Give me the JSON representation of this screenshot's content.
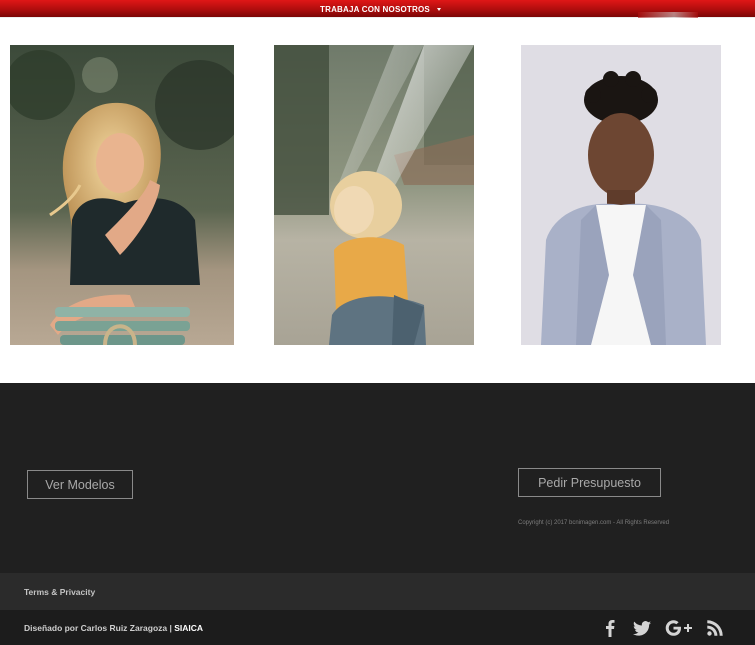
{
  "nav": {
    "item_label": "TRABAJA CON NOSOTROS",
    "accent_color": "#c00f0f"
  },
  "gallery": {
    "photos": [
      {
        "name": "model-woman-blonde-chair"
      },
      {
        "name": "model-woman-yellow-shirt"
      },
      {
        "name": "model-man-grey-blazer"
      }
    ]
  },
  "footer": {
    "models_button_label": "Ver Modelos",
    "quote_button_label": "Pedir Presupuesto",
    "copyright": "Copyright (c) 2017 bcnimagen.com - All Rights Reserved",
    "terms_label": "Terms & Privacity",
    "credit_prefix": "Diseñado por Carlos Ruiz Zaragoza | ",
    "credit_brand": "SIAICA",
    "social_icons": [
      "facebook-icon",
      "twitter-icon",
      "google-plus-icon",
      "rss-icon"
    ]
  },
  "colors": {
    "footer_dark": "#202020",
    "footer_strip": "#2b2b2b",
    "footer_bottom": "#1c1c1c",
    "button_border": "#8a8a8a"
  }
}
